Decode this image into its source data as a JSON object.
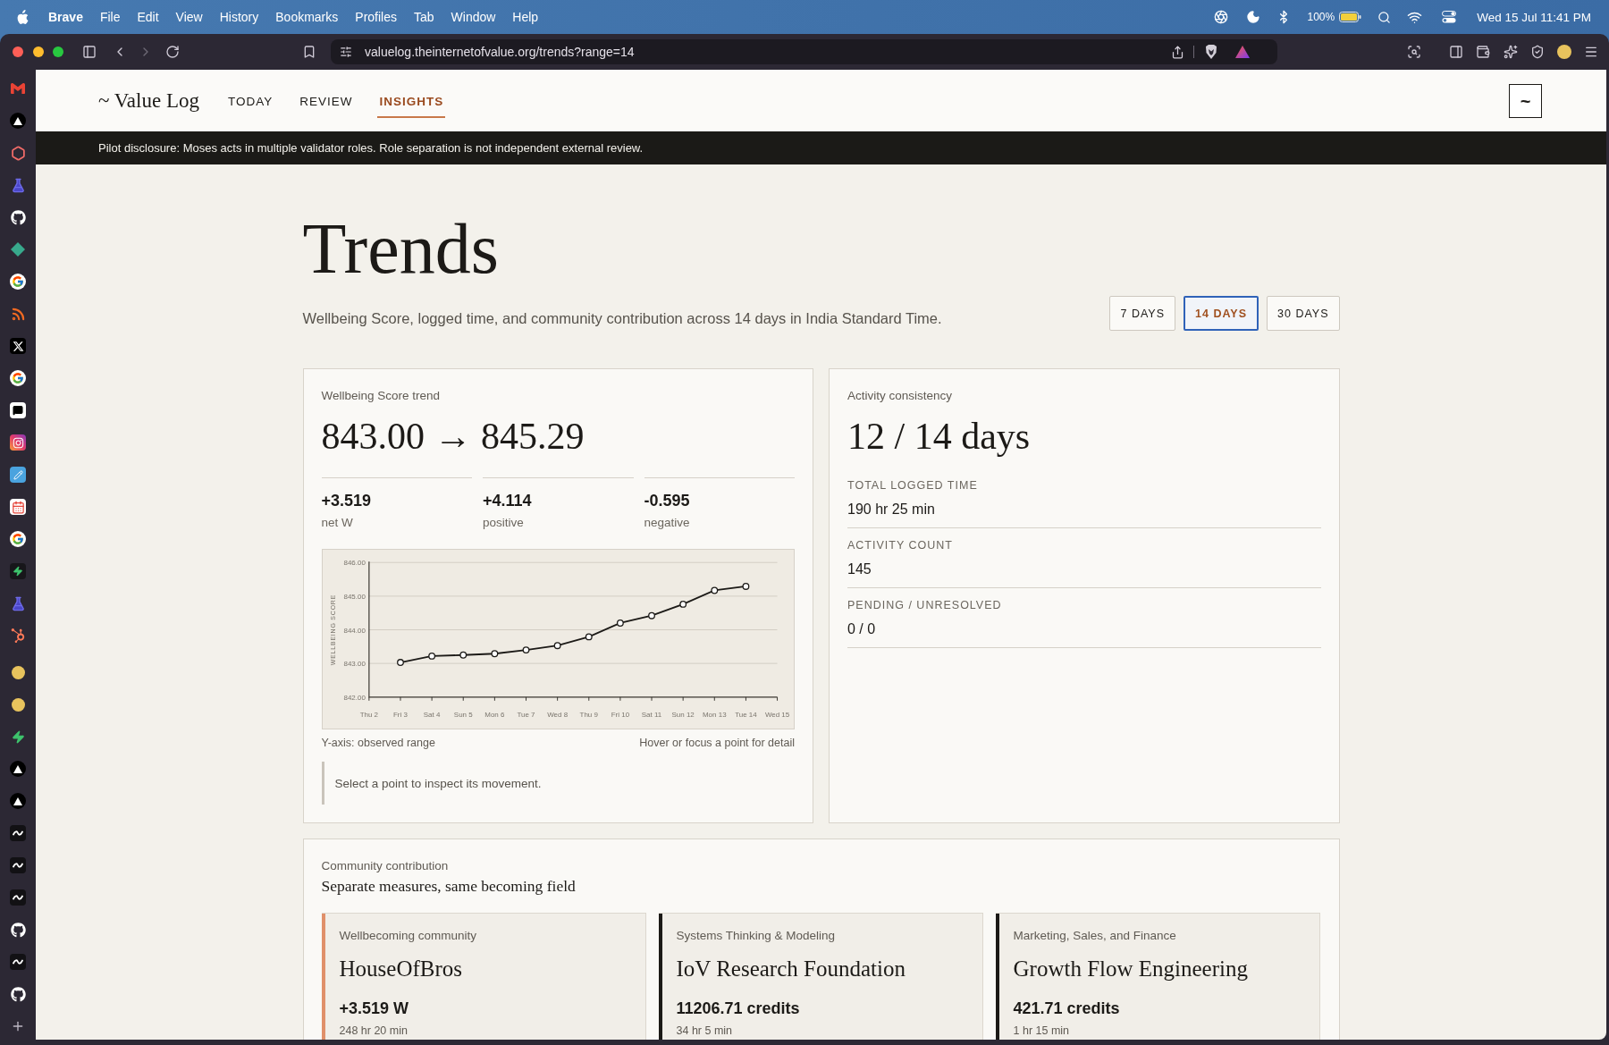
{
  "menu_bar": {
    "app_name": "Brave",
    "menus": [
      "File",
      "Edit",
      "View",
      "History",
      "Bookmarks",
      "Profiles",
      "Tab",
      "Window",
      "Help"
    ],
    "battery": "100%",
    "clock": "Wed 15 Jul 11:41 PM"
  },
  "browser": {
    "url": "valuelog.theinternetofvalue.org/trends?range=14",
    "forward_disabled": true
  },
  "header": {
    "logo": "~ Value Log",
    "nav": [
      {
        "label": "TODAY",
        "selected": false
      },
      {
        "label": "REVIEW",
        "selected": false
      },
      {
        "label": "INSIGHTS",
        "selected": true
      }
    ],
    "menu_button": "~"
  },
  "disclosure": "Pilot disclosure: Moses acts in multiple validator roles. Role separation is not independent external review.",
  "page": {
    "title": "Trends",
    "subtitle": "Wellbeing Score, logged time, and community contribution across 14 days in India Standard Time.",
    "ranges": [
      {
        "label": "7 DAYS",
        "selected": false
      },
      {
        "label": "14 DAYS",
        "selected": true
      },
      {
        "label": "30 DAYS",
        "selected": false
      }
    ]
  },
  "trend_card": {
    "label": "Wellbeing Score trend",
    "headline": "843.00 → 845.29",
    "stats": [
      {
        "value": "+3.519",
        "label": "net W"
      },
      {
        "value": "+4.114",
        "label": "positive"
      },
      {
        "value": "-0.595",
        "label": "negative"
      }
    ],
    "chart_data": {
      "type": "line",
      "ylabel": "WELLBEING SCORE",
      "categories": [
        "Thu 2",
        "Fri 3",
        "Sat 4",
        "Sun 5",
        "Mon 6",
        "Tue 7",
        "Wed 8",
        "Thu 9",
        "Fri 10",
        "Sat 11",
        "Sun 12",
        "Mon 13",
        "Tue 14",
        "Wed 15"
      ],
      "values": [
        null,
        843.03,
        843.22,
        843.25,
        843.29,
        843.4,
        843.53,
        843.79,
        844.2,
        844.42,
        844.76,
        845.17,
        845.29,
        null
      ],
      "ylim": [
        842,
        846
      ],
      "yticks": [
        {
          "value": 842,
          "label": "842.00"
        },
        {
          "value": 843,
          "label": "843.00"
        },
        {
          "value": 844,
          "label": "844.00"
        },
        {
          "value": 845,
          "label": "845.00"
        },
        {
          "value": 846,
          "label": "846.00"
        }
      ],
      "grid": true,
      "marker": true
    },
    "footnote_left": "Y-axis: observed range",
    "footnote_right": "Hover or focus a point for detail",
    "hint": "Select a point to inspect its movement."
  },
  "activity_card": {
    "label": "Activity consistency",
    "headline": "12 / 14 days",
    "metrics": [
      {
        "label": "TOTAL LOGGED TIME",
        "value": "190 hr 25 min"
      },
      {
        "label": "ACTIVITY COUNT",
        "value": "145"
      },
      {
        "label": "PENDING / UNRESOLVED",
        "value": "0 / 0"
      }
    ]
  },
  "community": {
    "label": "Community contribution",
    "title": "Separate measures, same becoming field",
    "items": [
      {
        "category": "Wellbecoming community",
        "name": "HouseOfBros",
        "value": "+3.519 W",
        "time": "248 hr 20 min",
        "color": "#e0906a"
      },
      {
        "category": "Systems Thinking & Modeling",
        "name": "IoV Research Foundation",
        "value": "11206.71 credits",
        "time": "34 hr 5 min",
        "color": "#1c1a17"
      },
      {
        "category": "Marketing, Sales, and Finance",
        "name": "Growth Flow Engineering",
        "value": "421.71 credits",
        "time": "1 hr 15 min",
        "color": "#1c1a17"
      }
    ]
  }
}
